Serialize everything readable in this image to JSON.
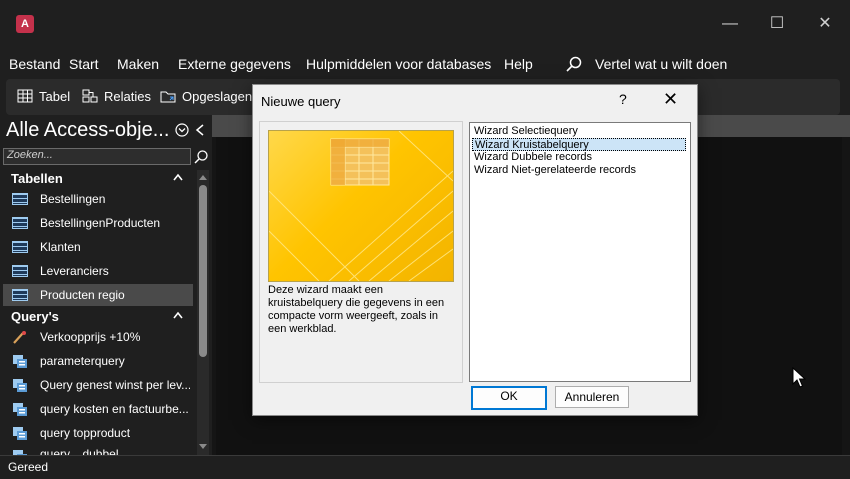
{
  "app": {
    "logo_letter": "A"
  },
  "window_controls": {
    "minimize": "—",
    "maximize": "☐",
    "close": "✕"
  },
  "menu": {
    "items": [
      "Bestand",
      "Start",
      "Maken",
      "Externe gegevens",
      "Hulpmiddelen voor databases",
      "Help"
    ],
    "search_label": "Vertel wat u wilt doen"
  },
  "ribbon": {
    "items": [
      "Tabel",
      "Relaties",
      "Opgeslagen e"
    ]
  },
  "nav": {
    "title": "Alle Access-obje...",
    "search_placeholder": "Zoeken...",
    "groups": [
      {
        "label": "Tabellen",
        "items": [
          "Bestellingen",
          "BestellingenProducten",
          "Klanten",
          "Leveranciers",
          "Producten regio"
        ]
      },
      {
        "label": "Query's",
        "items": [
          "Verkoopprijs +10%",
          "parameterquery",
          "Query genest winst per lev...",
          "query kosten en factuurbe...",
          "query topproduct",
          "query... dubbel..."
        ]
      }
    ],
    "selected_item": "Producten regio"
  },
  "status": {
    "text": "Gereed"
  },
  "dialog": {
    "title": "Nieuwe query",
    "help": "?",
    "close": "✕",
    "description": "Deze wizard maakt een kruistabelquery die gegevens in een compacte vorm weergeeft, zoals in een werkblad.",
    "options": [
      "Wizard Selectiequery",
      "Wizard Kruistabelquery",
      "Wizard Dubbele records",
      "Wizard Niet-gerelateerde records"
    ],
    "selected_index": 1,
    "ok_label": "OK",
    "cancel_label": "Annuleren"
  },
  "colors": {
    "accent": "#0078d4",
    "selection": "#cce4f7",
    "brand": "#c4314b"
  }
}
